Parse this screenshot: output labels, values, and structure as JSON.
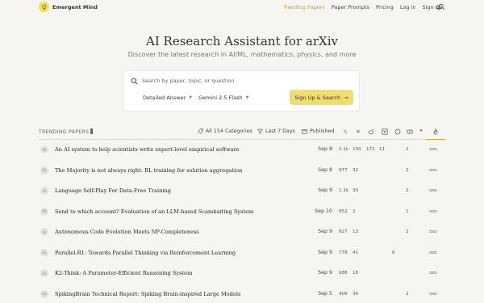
{
  "header": {
    "brand": "Emergent Mind",
    "nav": [
      "Trending Papers",
      "Paper Prompts",
      "Pricing",
      "Log in",
      "Sign up"
    ]
  },
  "hero": {
    "title": "AI Research Assistant for arXiv",
    "subtitle": "Discover the latest research in AI/ML, mathematics, physics, and more"
  },
  "search": {
    "placeholder": "Search by paper, topic, or question",
    "mode": "Detailed Answer",
    "model": "Gemini 2.5 Flash",
    "submit_label": "Sign Up & Search"
  },
  "filters": {
    "section_label": "TRENDING PAPERS",
    "category": "All 154 Categories",
    "period": "Last 7 Days",
    "sort": "Published",
    "source_icons": [
      "x-icon",
      "alphaxiv-icon",
      "reddit-icon",
      "hackernews-icon",
      "github-icon",
      "youtube-icon",
      "citations-icon",
      "flame-icon"
    ]
  },
  "papers": [
    {
      "avatar": "AI",
      "title": "An AI system to help scientists write expert-level empirical software",
      "date": "Sep 8",
      "x": "2.1k",
      "ax": "100",
      "reddit": "172",
      "hn": "11",
      "gh": "",
      "yt": "2",
      "cite": ""
    },
    {
      "avatar": "GL",
      "title": "The Majority is not always right: RL training for solution aggregation",
      "date": "Sep 8",
      "x": "977",
      "ax": "32",
      "reddit": "",
      "hn": "",
      "gh": "",
      "yt": "2",
      "cite": ""
    },
    {
      "avatar": "AI",
      "title": "Language Self-Play For Data-Free Training",
      "date": "Sep 9",
      "x": "1.1k",
      "ax": "30",
      "reddit": "",
      "hn": "",
      "gh": "",
      "yt": "2",
      "cite": ""
    },
    {
      "avatar": "CR",
      "title": "Send to which account? Evaluation of an LLM-based Scambaiting System",
      "date": "Sep 10",
      "x": "952",
      "ax": "2",
      "reddit": "",
      "hn": "",
      "gh": "",
      "yt": "1",
      "cite": ""
    },
    {
      "avatar": "AI",
      "title": "Autonomous Code Evolution Meets NP-Completeness",
      "date": "Sep 9",
      "x": "827",
      "ax": "13",
      "reddit": "",
      "hn": "",
      "gh": "",
      "yt": "2",
      "cite": ""
    },
    {
      "avatar": "CL",
      "title": "Parallel-R1: Towards Parallel Thinking via Reinforcement Learning",
      "date": "Sep 9",
      "x": "778",
      "ax": "41",
      "reddit": "",
      "hn": "",
      "gh": "8",
      "yt": "",
      "cite": ""
    },
    {
      "avatar": "LG",
      "title": "K2-Think: A Parameter-Efficient Reasoning System",
      "date": "Sep 9",
      "x": "688",
      "ax": "18",
      "reddit": "",
      "hn": "",
      "gh": "",
      "yt": "",
      "cite": ""
    },
    {
      "avatar": "LG",
      "title": "SpikingBrain Technical Report: Spiking Brain-inspired Large Models",
      "date": "Sep 5",
      "x": "406",
      "ax": "34",
      "reddit": "",
      "hn": "",
      "gh": "",
      "yt": "2",
      "cite": ""
    }
  ]
}
